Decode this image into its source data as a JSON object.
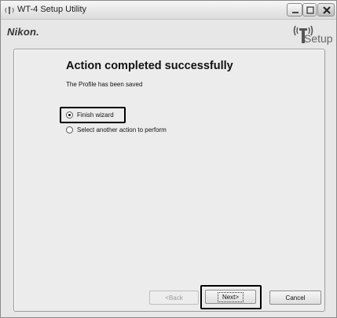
{
  "window": {
    "title": "WT-4 Setup Utility"
  },
  "header": {
    "brand": "Nikon.",
    "setup_logo_text": "Setup"
  },
  "content": {
    "heading": "Action completed successfully",
    "subtitle": "The Profile has been saved",
    "options": [
      {
        "label": "Finish wizard",
        "selected": true
      },
      {
        "label": "Select another action to perform",
        "selected": false
      }
    ]
  },
  "buttons": {
    "back": "<Back",
    "next": "Next>",
    "cancel": "Cancel"
  },
  "icons": [
    "app-icon",
    "minimize-icon",
    "maximize-icon",
    "close-icon",
    "wireless-antenna-icon"
  ]
}
